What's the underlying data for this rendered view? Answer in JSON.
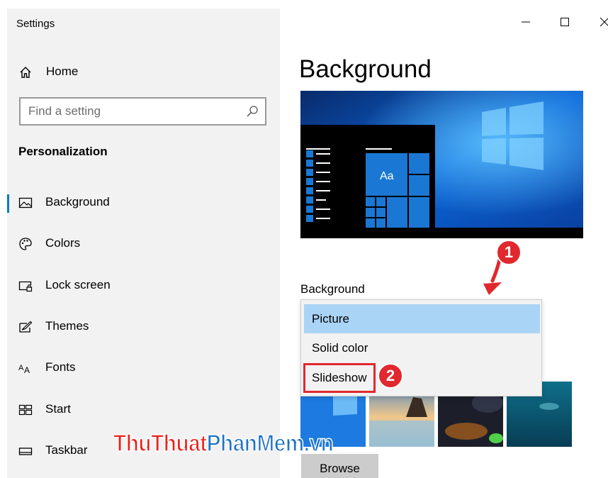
{
  "window": {
    "title": "Settings"
  },
  "sidebar": {
    "home_label": "Home",
    "search_placeholder": "Find a setting",
    "section_title": "Personalization",
    "items": [
      {
        "label": "Background",
        "icon": "picture-icon",
        "active": true
      },
      {
        "label": "Colors",
        "icon": "palette-icon"
      },
      {
        "label": "Lock screen",
        "icon": "lock-screen-icon"
      },
      {
        "label": "Themes",
        "icon": "themes-brush-icon"
      },
      {
        "label": "Fonts",
        "icon": "fonts-icon"
      },
      {
        "label": "Start",
        "icon": "start-tiles-icon"
      },
      {
        "label": "Taskbar",
        "icon": "taskbar-icon"
      }
    ]
  },
  "main": {
    "title": "Background",
    "field_label": "Background",
    "preview": {
      "tile_text": "Aa"
    },
    "dropdown": {
      "selected": "Picture",
      "options": [
        "Picture",
        "Solid color",
        "Slideshow"
      ]
    },
    "browse_label": "Browse"
  },
  "annotations": {
    "badge_1": "1",
    "badge_2": "2"
  },
  "watermark": {
    "part1": "ThuThuat",
    "part2": "PhanMem.vn"
  },
  "colors": {
    "accent": "#0078d7",
    "selection": "#aad4f6",
    "annotation_red": "#e0282e"
  }
}
